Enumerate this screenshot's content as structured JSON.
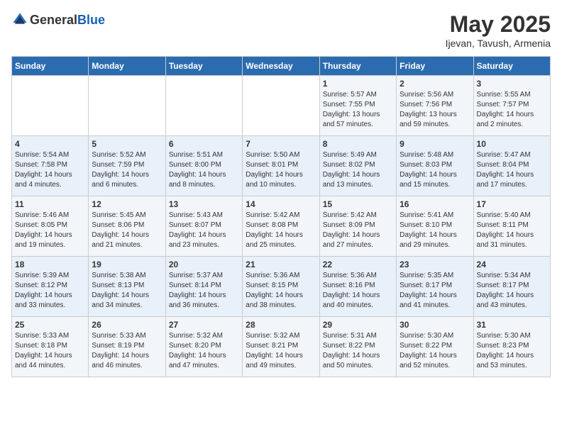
{
  "header": {
    "logo_general": "General",
    "logo_blue": "Blue",
    "month": "May 2025",
    "location": "Ijevan, Tavush, Armenia"
  },
  "weekdays": [
    "Sunday",
    "Monday",
    "Tuesday",
    "Wednesday",
    "Thursday",
    "Friday",
    "Saturday"
  ],
  "weeks": [
    [
      {
        "day": "",
        "info": ""
      },
      {
        "day": "",
        "info": ""
      },
      {
        "day": "",
        "info": ""
      },
      {
        "day": "",
        "info": ""
      },
      {
        "day": "1",
        "info": "Sunrise: 5:57 AM\nSunset: 7:55 PM\nDaylight: 13 hours and 57 minutes."
      },
      {
        "day": "2",
        "info": "Sunrise: 5:56 AM\nSunset: 7:56 PM\nDaylight: 13 hours and 59 minutes."
      },
      {
        "day": "3",
        "info": "Sunrise: 5:55 AM\nSunset: 7:57 PM\nDaylight: 14 hours and 2 minutes."
      }
    ],
    [
      {
        "day": "4",
        "info": "Sunrise: 5:54 AM\nSunset: 7:58 PM\nDaylight: 14 hours and 4 minutes."
      },
      {
        "day": "5",
        "info": "Sunrise: 5:52 AM\nSunset: 7:59 PM\nDaylight: 14 hours and 6 minutes."
      },
      {
        "day": "6",
        "info": "Sunrise: 5:51 AM\nSunset: 8:00 PM\nDaylight: 14 hours and 8 minutes."
      },
      {
        "day": "7",
        "info": "Sunrise: 5:50 AM\nSunset: 8:01 PM\nDaylight: 14 hours and 10 minutes."
      },
      {
        "day": "8",
        "info": "Sunrise: 5:49 AM\nSunset: 8:02 PM\nDaylight: 14 hours and 13 minutes."
      },
      {
        "day": "9",
        "info": "Sunrise: 5:48 AM\nSunset: 8:03 PM\nDaylight: 14 hours and 15 minutes."
      },
      {
        "day": "10",
        "info": "Sunrise: 5:47 AM\nSunset: 8:04 PM\nDaylight: 14 hours and 17 minutes."
      }
    ],
    [
      {
        "day": "11",
        "info": "Sunrise: 5:46 AM\nSunset: 8:05 PM\nDaylight: 14 hours and 19 minutes."
      },
      {
        "day": "12",
        "info": "Sunrise: 5:45 AM\nSunset: 8:06 PM\nDaylight: 14 hours and 21 minutes."
      },
      {
        "day": "13",
        "info": "Sunrise: 5:43 AM\nSunset: 8:07 PM\nDaylight: 14 hours and 23 minutes."
      },
      {
        "day": "14",
        "info": "Sunrise: 5:42 AM\nSunset: 8:08 PM\nDaylight: 14 hours and 25 minutes."
      },
      {
        "day": "15",
        "info": "Sunrise: 5:42 AM\nSunset: 8:09 PM\nDaylight: 14 hours and 27 minutes."
      },
      {
        "day": "16",
        "info": "Sunrise: 5:41 AM\nSunset: 8:10 PM\nDaylight: 14 hours and 29 minutes."
      },
      {
        "day": "17",
        "info": "Sunrise: 5:40 AM\nSunset: 8:11 PM\nDaylight: 14 hours and 31 minutes."
      }
    ],
    [
      {
        "day": "18",
        "info": "Sunrise: 5:39 AM\nSunset: 8:12 PM\nDaylight: 14 hours and 33 minutes."
      },
      {
        "day": "19",
        "info": "Sunrise: 5:38 AM\nSunset: 8:13 PM\nDaylight: 14 hours and 34 minutes."
      },
      {
        "day": "20",
        "info": "Sunrise: 5:37 AM\nSunset: 8:14 PM\nDaylight: 14 hours and 36 minutes."
      },
      {
        "day": "21",
        "info": "Sunrise: 5:36 AM\nSunset: 8:15 PM\nDaylight: 14 hours and 38 minutes."
      },
      {
        "day": "22",
        "info": "Sunrise: 5:36 AM\nSunset: 8:16 PM\nDaylight: 14 hours and 40 minutes."
      },
      {
        "day": "23",
        "info": "Sunrise: 5:35 AM\nSunset: 8:17 PM\nDaylight: 14 hours and 41 minutes."
      },
      {
        "day": "24",
        "info": "Sunrise: 5:34 AM\nSunset: 8:17 PM\nDaylight: 14 hours and 43 minutes."
      }
    ],
    [
      {
        "day": "25",
        "info": "Sunrise: 5:33 AM\nSunset: 8:18 PM\nDaylight: 14 hours and 44 minutes."
      },
      {
        "day": "26",
        "info": "Sunrise: 5:33 AM\nSunset: 8:19 PM\nDaylight: 14 hours and 46 minutes."
      },
      {
        "day": "27",
        "info": "Sunrise: 5:32 AM\nSunset: 8:20 PM\nDaylight: 14 hours and 47 minutes."
      },
      {
        "day": "28",
        "info": "Sunrise: 5:32 AM\nSunset: 8:21 PM\nDaylight: 14 hours and 49 minutes."
      },
      {
        "day": "29",
        "info": "Sunrise: 5:31 AM\nSunset: 8:22 PM\nDaylight: 14 hours and 50 minutes."
      },
      {
        "day": "30",
        "info": "Sunrise: 5:30 AM\nSunset: 8:22 PM\nDaylight: 14 hours and 52 minutes."
      },
      {
        "day": "31",
        "info": "Sunrise: 5:30 AM\nSunset: 8:23 PM\nDaylight: 14 hours and 53 minutes."
      }
    ]
  ]
}
